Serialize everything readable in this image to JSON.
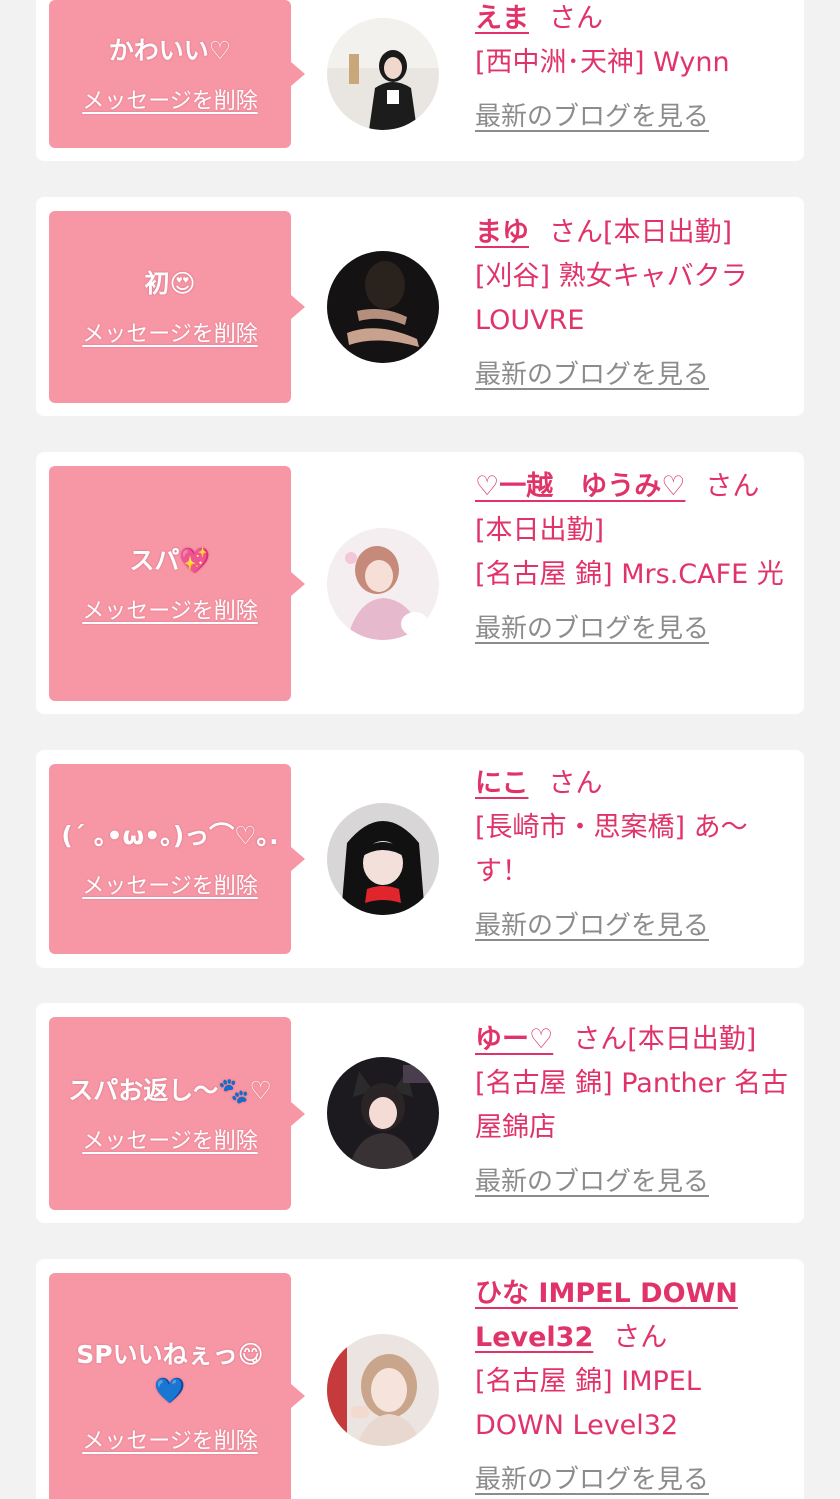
{
  "delete_label": "メッセージを削除",
  "san_label": "さん",
  "blog_label": "最新のブログを見る",
  "colors": {
    "bubble": "#f797a6",
    "accent": "#e0336a",
    "link_gray": "#8c8c8c",
    "background": "#f2f2f2"
  },
  "cards": [
    {
      "message": "かわいい♡",
      "name": "えま",
      "status": "",
      "shop": "[西中洲･天神] Wynn",
      "avatar_icon": "user-photo-1"
    },
    {
      "message": "初😍",
      "name": "まゆ",
      "status": "[本日出勤]",
      "shop": "[刈谷] 熟女キャバクラ LOUVRE",
      "avatar_icon": "user-photo-2"
    },
    {
      "message": "スパ💖",
      "name": "♡一越　ゆうみ♡",
      "status": "[本日出勤]",
      "shop": "[名古屋 錦] Mrs.CAFE 光",
      "avatar_icon": "user-photo-3"
    },
    {
      "message": "(´ ｡•ω•｡)っ⌒♡｡.",
      "name": "にこ",
      "status": "",
      "shop": "[長崎市・思案橋] あ〜す！",
      "avatar_icon": "user-photo-4"
    },
    {
      "message": "スパお返し〜🐾♡",
      "name": "ゆー♡",
      "status": "[本日出勤]",
      "shop": "[名古屋 錦] Panther 名古屋錦店",
      "avatar_icon": "user-photo-5"
    },
    {
      "message": "SPいいねぇっ😋💙",
      "name": "ひな IMPEL DOWN Level32",
      "status": "",
      "shop": "[名古屋 錦] IMPEL DOWN Level32",
      "avatar_icon": "user-photo-6"
    }
  ]
}
